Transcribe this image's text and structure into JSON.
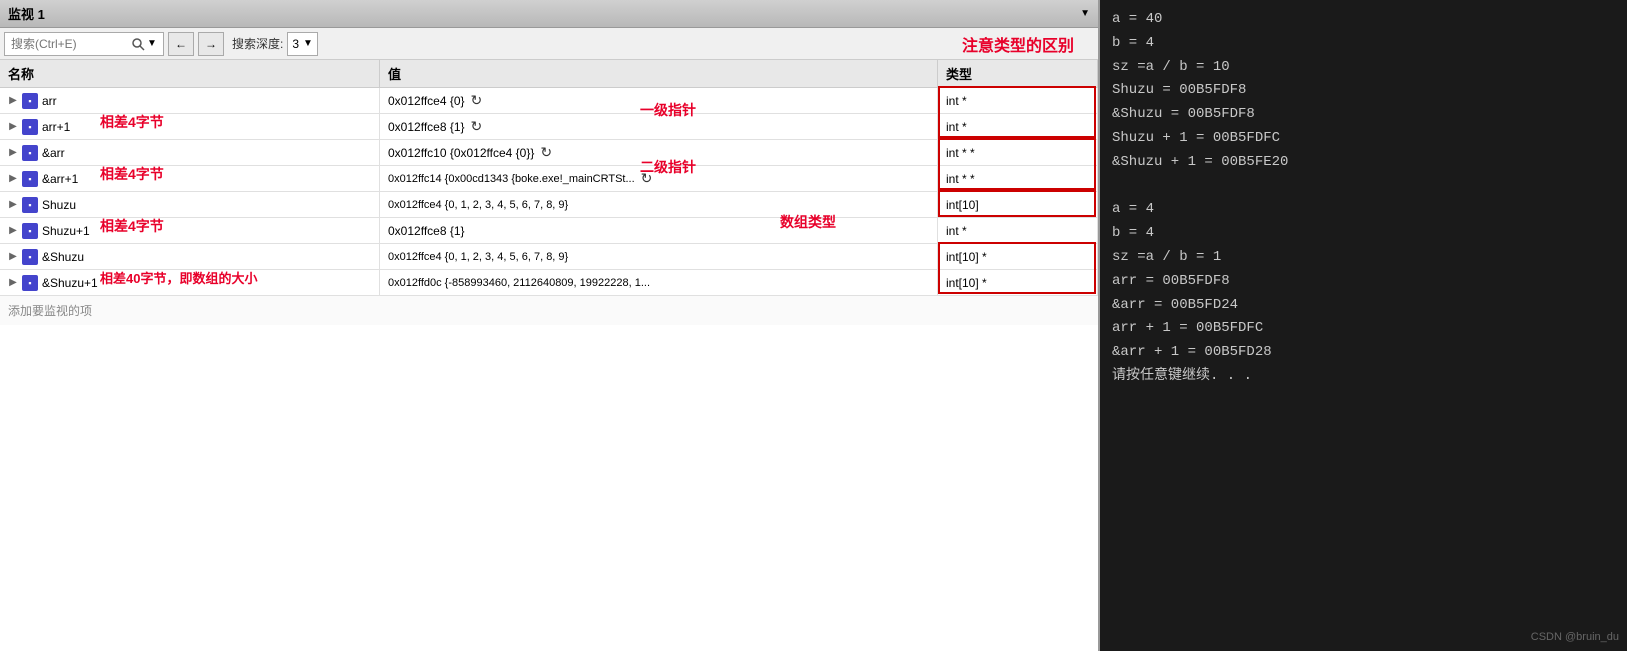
{
  "title": "监视 1",
  "toolbar": {
    "search_placeholder": "搜索(Ctrl+E)",
    "depth_label": "搜索深度:",
    "depth_value": "3",
    "type_note": "注意类型的区别"
  },
  "table": {
    "headers": [
      "名称",
      "值",
      "类型"
    ],
    "rows": [
      {
        "name": "arr",
        "annotation": "相差4字节",
        "value": "0x012ffce4 {0}",
        "type": "int *",
        "type_highlighted": true
      },
      {
        "name": "arr+1",
        "annotation": "",
        "value": "0x012ffce8 {1}",
        "type": "int *",
        "type_highlighted": true
      },
      {
        "name": "&arr",
        "annotation": "相差4字节",
        "value": "0x012ffc10 {0x012ffce4 {0}}",
        "type": "int * *",
        "type_highlighted": true
      },
      {
        "name": "&arr+1",
        "annotation": "",
        "value": "0x012ffc14 {0x00cd1343 {boke.exe!_mainCRTSt...",
        "type": "int * *",
        "type_highlighted": true
      },
      {
        "name": "Shuzu",
        "annotation": "相差4字节",
        "value": "0x012ffce4 {0, 1, 2, 3, 4, 5, 6, 7, 8, 9}",
        "type": "int[10]",
        "type_highlighted": true
      },
      {
        "name": "Shuzu+1",
        "annotation": "",
        "value": "0x012ffce8 {1}",
        "type": "int *",
        "type_highlighted": false
      },
      {
        "name": "&Shuzu",
        "annotation": "相差40字节，即数组的大小",
        "value": "0x012ffce4 {0, 1, 2, 3, 4, 5, 6, 7, 8, 9}",
        "type": "int[10] *",
        "type_highlighted": true
      },
      {
        "name": "&Shuzu+1",
        "annotation": "",
        "value": "0x012ffd0c {-858993460, 2112640809, 19922228, 1...",
        "type": "int[10] *",
        "type_highlighted": true
      }
    ],
    "add_row_label": "添加要监视的项"
  },
  "annotations": {
    "diff4_1": "相差4字节",
    "diff4_2": "相差4字节",
    "diff4_3": "相差4字节",
    "diff40": "相差40字节，即数组的大小",
    "pointer1": "一级指针",
    "pointer2": "二级指针",
    "array_type": "数组类型"
  },
  "console": {
    "lines": [
      "a = 40",
      "b = 4",
      "sz =a / b = 10",
      "Shuzu = 00B5FDF8",
      "&Shuzu = 00B5FDF8",
      "Shuzu + 1 = 00B5FDFC",
      "&Shuzu + 1 = 00B5FE20",
      "",
      "a = 4",
      "b = 4",
      "sz =a / b = 1",
      "arr = 00B5FDF8",
      "&arr = 00B5FD24",
      "arr + 1 = 00B5FDFC",
      "&arr + 1 = 00B5FD28",
      "请按任意键继续. . ."
    ]
  },
  "watermark": "CSDN @bruin_du"
}
